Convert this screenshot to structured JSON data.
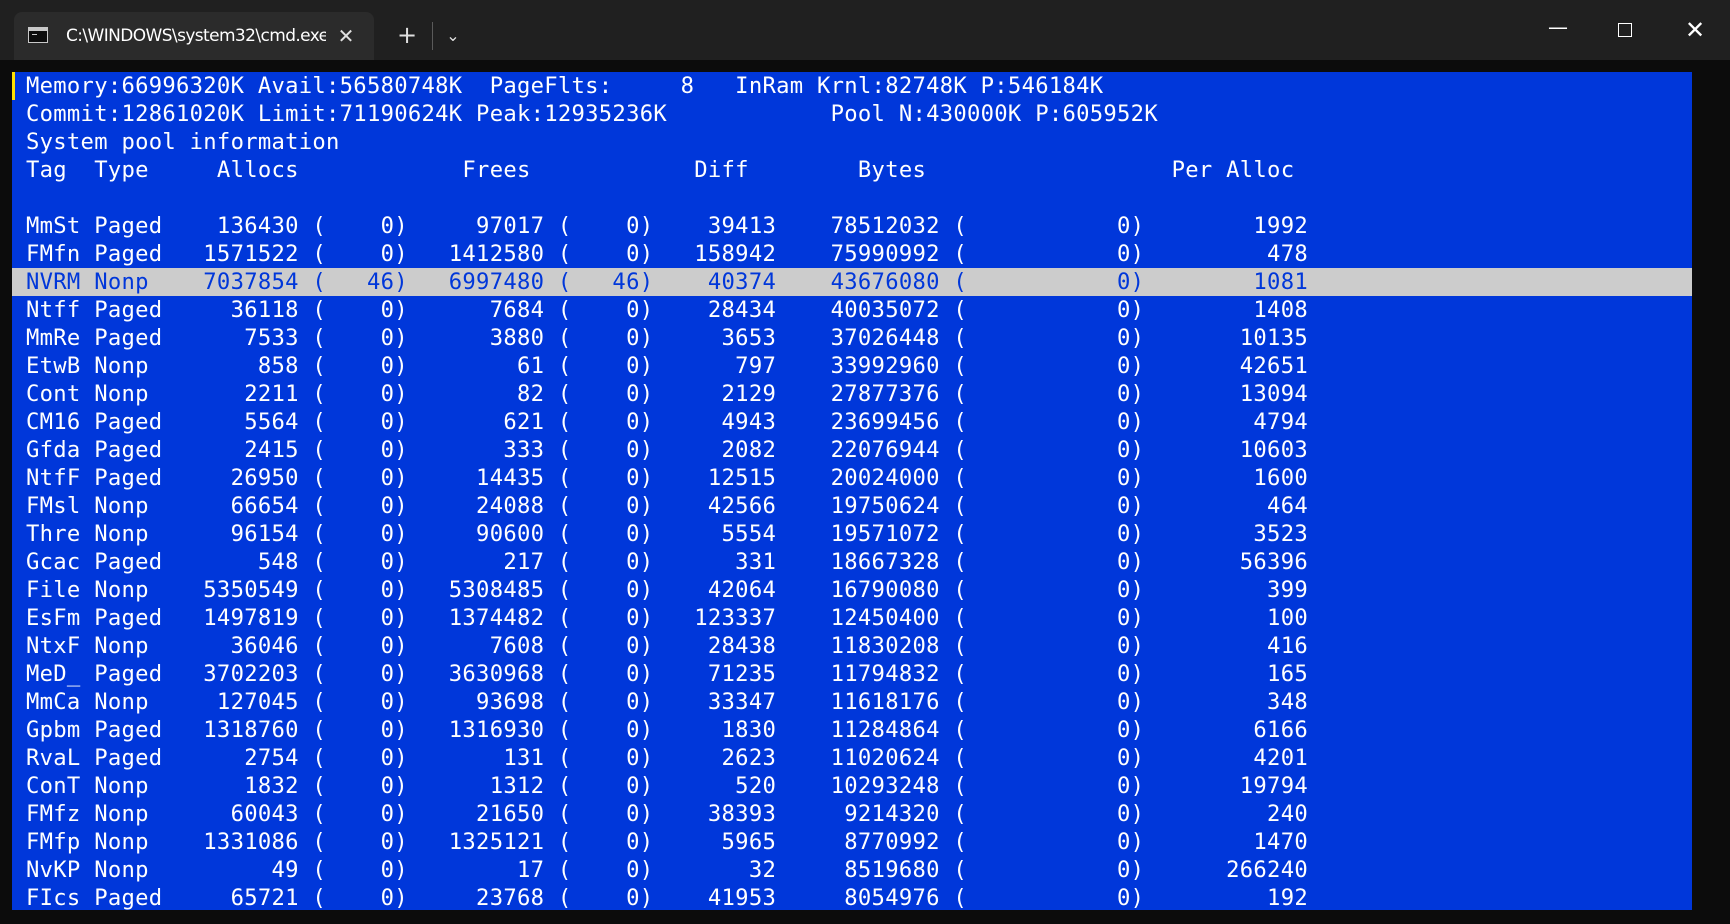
{
  "window": {
    "tab_title": "C:\\WINDOWS\\system32\\cmd.exe",
    "new_tab_label": "+",
    "dropdown_label": "⌄",
    "close_tab_label": "✕",
    "minimize_label": "—",
    "close_label": "✕"
  },
  "terminal": {
    "header": [
      "Memory:66996320K Avail:56580748K  PageFlts:     8   InRam Krnl:82748K P:546184K",
      "Commit:12861020K Limit:71190624K Peak:12935236K            Pool N:430000K P:605952K",
      "System pool information",
      "Tag  Type     Allocs            Frees            Diff        Bytes                  Per Alloc"
    ],
    "selected_index": 2,
    "rows": [
      "MmSt Paged    136430 (    0)     97017 (    0)    39413    78512032 (           0)        1992",
      "FMfn Paged   1571522 (    0)   1412580 (    0)   158942    75990992 (           0)         478",
      "NVRM Nonp    7037854 (   46)   6997480 (   46)    40374    43676080 (           0)        1081",
      "Ntff Paged     36118 (    0)      7684 (    0)    28434    40035072 (           0)        1408",
      "MmRe Paged      7533 (    0)      3880 (    0)     3653    37026448 (           0)       10135",
      "EtwB Nonp        858 (    0)        61 (    0)      797    33992960 (           0)       42651",
      "Cont Nonp       2211 (    0)        82 (    0)     2129    27877376 (           0)       13094",
      "CM16 Paged      5564 (    0)       621 (    0)     4943    23699456 (           0)        4794",
      "Gfda Paged      2415 (    0)       333 (    0)     2082    22076944 (           0)       10603",
      "NtfF Paged     26950 (    0)     14435 (    0)    12515    20024000 (           0)        1600",
      "FMsl Nonp      66654 (    0)     24088 (    0)    42566    19750624 (           0)         464",
      "Thre Nonp      96154 (    0)     90600 (    0)     5554    19571072 (           0)        3523",
      "Gcac Paged       548 (    0)       217 (    0)      331    18667328 (           0)       56396",
      "File Nonp    5350549 (    0)   5308485 (    0)    42064    16790080 (           0)         399",
      "EsFm Paged   1497819 (    0)   1374482 (    0)   123337    12450400 (           0)         100",
      "NtxF Nonp      36046 (    0)      7608 (    0)    28438    11830208 (           0)         416",
      "MeD_ Paged   3702203 (    0)   3630968 (    0)    71235    11794832 (           0)         165",
      "MmCa Nonp     127045 (    0)     93698 (    0)    33347    11618176 (           0)         348",
      "Gpbm Paged   1318760 (    0)   1316930 (    0)     1830    11284864 (           0)        6166",
      "RvaL Paged      2754 (    0)       131 (    0)     2623    11020624 (           0)        4201",
      "ConT Nonp       1832 (    0)      1312 (    0)      520    10293248 (           0)       19794",
      "FMfz Nonp      60043 (    0)     21650 (    0)    38393     9214320 (           0)         240",
      "FMfp Nonp    1331086 (    0)   1325121 (    0)     5965     8770992 (           0)        1470",
      "NvKP Nonp         49 (    0)        17 (    0)       32     8519680 (           0)      266240",
      "FIcs Paged     65721 (    0)     23768 (    0)    41953     8054976 (           0)         192"
    ]
  }
}
